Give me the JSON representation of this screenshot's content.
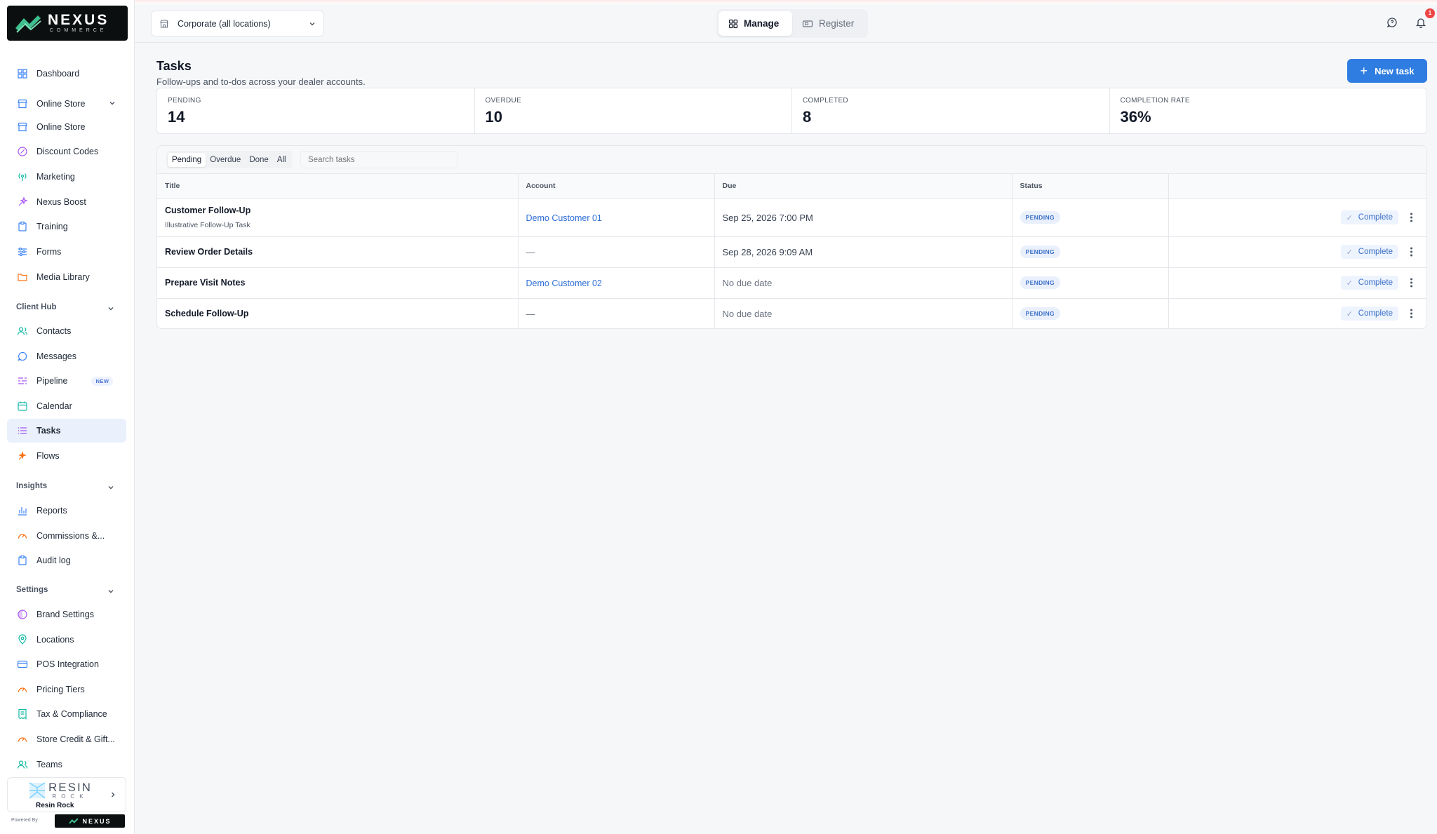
{
  "app": {
    "logo_main": "NEXUS",
    "logo_sub": "COMMERCE"
  },
  "sidebar": {
    "items_top": [
      {
        "label": "Dashboard",
        "icon": "grid-icon",
        "color": "#3b82f6"
      },
      {
        "label": "Online Store",
        "icon": "store-icon",
        "color": "#3b82f6"
      },
      {
        "label": "Online Store",
        "icon": "store-icon",
        "color": "#3b82f6"
      },
      {
        "label": "Discount Codes",
        "icon": "discount-icon",
        "color": "#a855f7"
      },
      {
        "label": "Marketing",
        "icon": "broadcast-icon",
        "color": "#14b8a6"
      },
      {
        "label": "Nexus Boost",
        "icon": "sparkle-icon",
        "color": "#a855f7"
      },
      {
        "label": "Training",
        "icon": "clipboard-icon",
        "color": "#3b82f6"
      },
      {
        "label": "Forms",
        "icon": "sliders-icon",
        "color": "#3b82f6"
      },
      {
        "label": "Media Library",
        "icon": "folder-icon",
        "color": "#f97316"
      }
    ],
    "section_client_hub": "Client Hub",
    "items_client_hub": [
      {
        "label": "Contacts",
        "icon": "users-icon",
        "color": "#14b8a6"
      },
      {
        "label": "Messages",
        "icon": "chat-icon",
        "color": "#3b82f6"
      },
      {
        "label": "Pipeline",
        "icon": "pipeline-icon",
        "color": "#a855f7",
        "badge": "NEW"
      },
      {
        "label": "Calendar",
        "icon": "calendar-icon",
        "color": "#14b8a6"
      },
      {
        "label": "Tasks",
        "icon": "list-icon",
        "color": "#a855f7"
      },
      {
        "label": "Flows",
        "icon": "flow-icon",
        "color": "#f97316"
      }
    ],
    "section_insights": "Insights",
    "items_insights": [
      {
        "label": "Reports",
        "icon": "bar-chart-icon",
        "color": "#3b82f6"
      },
      {
        "label": "Commissions &...",
        "icon": "gauge-icon",
        "color": "#f97316"
      },
      {
        "label": "Audit log",
        "icon": "clipboard-icon",
        "color": "#3b82f6"
      }
    ],
    "section_settings": "Settings",
    "items_settings": [
      {
        "label": "Brand Settings",
        "icon": "palette-icon",
        "color": "#a855f7"
      },
      {
        "label": "Locations",
        "icon": "pin-icon",
        "color": "#14b8a6"
      },
      {
        "label": "POS Integration",
        "icon": "card-icon",
        "color": "#3b82f6"
      },
      {
        "label": "Pricing Tiers",
        "icon": "gauge-icon",
        "color": "#f97316"
      },
      {
        "label": "Tax & Compliance",
        "icon": "receipt-icon",
        "color": "#14b8a6"
      },
      {
        "label": "Store Credit & Gift...",
        "icon": "gauge-icon",
        "color": "#f97316"
      },
      {
        "label": "Teams",
        "icon": "users-icon",
        "color": "#14b8a6"
      }
    ],
    "brand": {
      "logo_main": "RESIN",
      "logo_sub": "ROCK",
      "name": "Resin Rock"
    },
    "powered_by": "Powered By",
    "powered_logo": "NEXUS"
  },
  "header": {
    "location_select": "Corporate (all locations)",
    "mode_manage": "Manage",
    "mode_register": "Register",
    "notification_count": "1"
  },
  "page": {
    "title": "Tasks",
    "subtitle": "Follow-ups and to-dos across your dealer accounts.",
    "new_task_label": "New task"
  },
  "stats": [
    {
      "label": "PENDING",
      "value": "14"
    },
    {
      "label": "OVERDUE",
      "value": "10"
    },
    {
      "label": "COMPLETED",
      "value": "8"
    },
    {
      "label": "COMPLETION RATE",
      "value": "36%"
    }
  ],
  "filters": {
    "tabs": [
      "Pending",
      "Overdue",
      "Done",
      "All"
    ],
    "active_tab": "Pending",
    "search_placeholder": "Search tasks"
  },
  "table": {
    "columns": [
      "Title",
      "Account",
      "Due",
      "Status",
      ""
    ],
    "rows": [
      {
        "title": "Customer Follow-Up",
        "subtitle": "Illustrative Follow-Up Task",
        "account": "Demo Customer 01",
        "due": "Sep 25, 2026 7:00 PM",
        "status": "PENDING",
        "action": "Complete"
      },
      {
        "title": "Review Order Details",
        "subtitle": "",
        "account": "—",
        "due": "Sep 28, 2026 9:09 AM",
        "status": "PENDING",
        "action": "Complete"
      },
      {
        "title": "Prepare Visit Notes",
        "subtitle": "",
        "account": "Demo Customer 02",
        "due": "No due date",
        "status": "PENDING",
        "action": "Complete"
      },
      {
        "title": "Schedule Follow-Up",
        "subtitle": "",
        "account": "—",
        "due": "No due date",
        "status": "PENDING",
        "action": "Complete"
      }
    ]
  },
  "colors": {
    "accent": "#2f7de1",
    "active_nav_bg": "#eaf1fc",
    "status_bg": "#e9f0fc",
    "status_text": "#3b6fc8",
    "notif": "#ef4444"
  }
}
